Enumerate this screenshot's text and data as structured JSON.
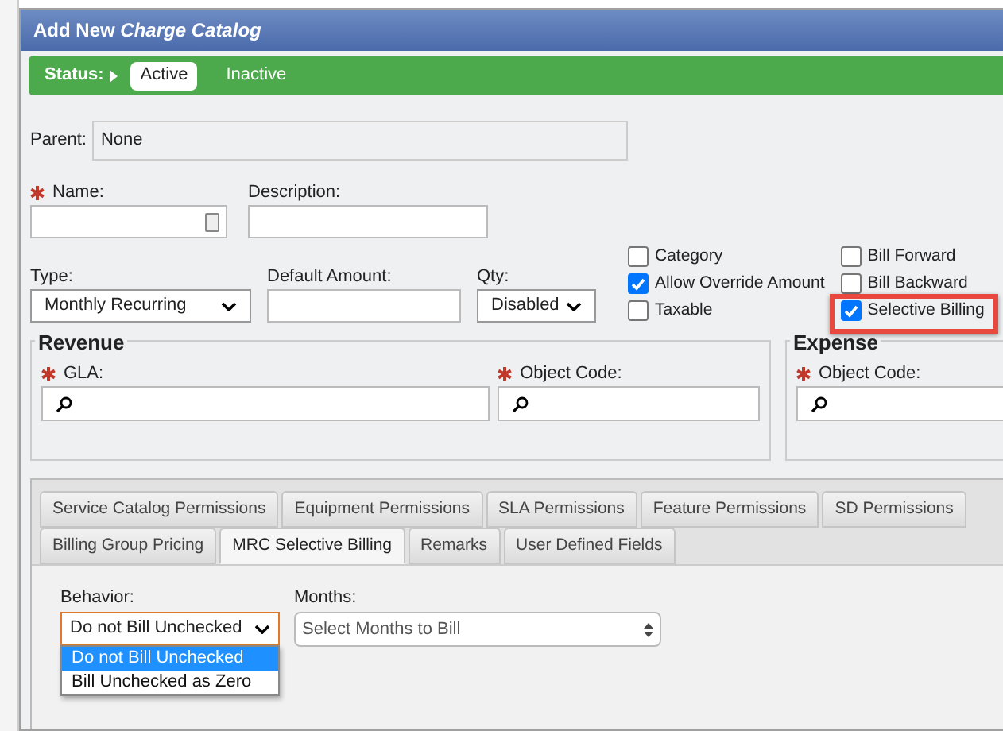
{
  "dialog": {
    "title": "Add New **Charge Catalog**"
  },
  "status": {
    "label": "Status:",
    "options": [
      {
        "label": "Active",
        "selected": true
      },
      {
        "label": "Inactive",
        "selected": false
      }
    ]
  },
  "parent": {
    "label": "Parent:",
    "value": "None"
  },
  "name": {
    "label": "Name:",
    "required": true
  },
  "description": {
    "label": "Description:"
  },
  "type": {
    "label": "Type:",
    "value": "Monthly Recurring"
  },
  "default_amount": {
    "label": "Default Amount:"
  },
  "qty": {
    "label": "Qty:",
    "value": "Disabled"
  },
  "checkboxes_left": [
    {
      "label": "Category",
      "checked": false
    },
    {
      "label": "Allow Override Amount",
      "checked": true
    },
    {
      "label": "Taxable",
      "checked": false
    }
  ],
  "checkboxes_right": [
    {
      "label": "Bill Forward",
      "checked": false,
      "highlighted": false
    },
    {
      "label": "Bill Backward",
      "checked": false,
      "highlighted": false
    },
    {
      "label": "Selective Billing",
      "checked": true,
      "highlighted": true
    }
  ],
  "revenue": {
    "title": "Revenue",
    "fields": [
      {
        "label": "GLA:",
        "required": true
      },
      {
        "label": "Object Code:",
        "required": true
      }
    ]
  },
  "expense": {
    "title": "Expense",
    "fields": [
      {
        "label": "Object Code:",
        "required": true
      }
    ]
  },
  "tab_rows": [
    [
      {
        "label": "Service Catalog Permissions",
        "selected": false
      },
      {
        "label": "Equipment Permissions",
        "selected": false
      },
      {
        "label": "SLA Permissions",
        "selected": false
      },
      {
        "label": "Feature Permissions",
        "selected": false
      },
      {
        "label": "SD Permissions",
        "selected": false
      }
    ],
    [
      {
        "label": "Billing Group Pricing",
        "selected": false
      },
      {
        "label": "MRC Selective Billing",
        "selected": true
      },
      {
        "label": "Remarks",
        "selected": false
      },
      {
        "label": "User Defined Fields",
        "selected": false
      }
    ]
  ],
  "behavior": {
    "label": "Behavior:",
    "value": "Do not Bill Unchecked",
    "expanded": true,
    "options": [
      {
        "label": "Do not Bill Unchecked",
        "selected": true
      },
      {
        "label": "Bill Unchecked as Zero",
        "selected": false
      }
    ]
  },
  "months": {
    "label": "Months:",
    "placeholder": "Select Months to Bill"
  }
}
